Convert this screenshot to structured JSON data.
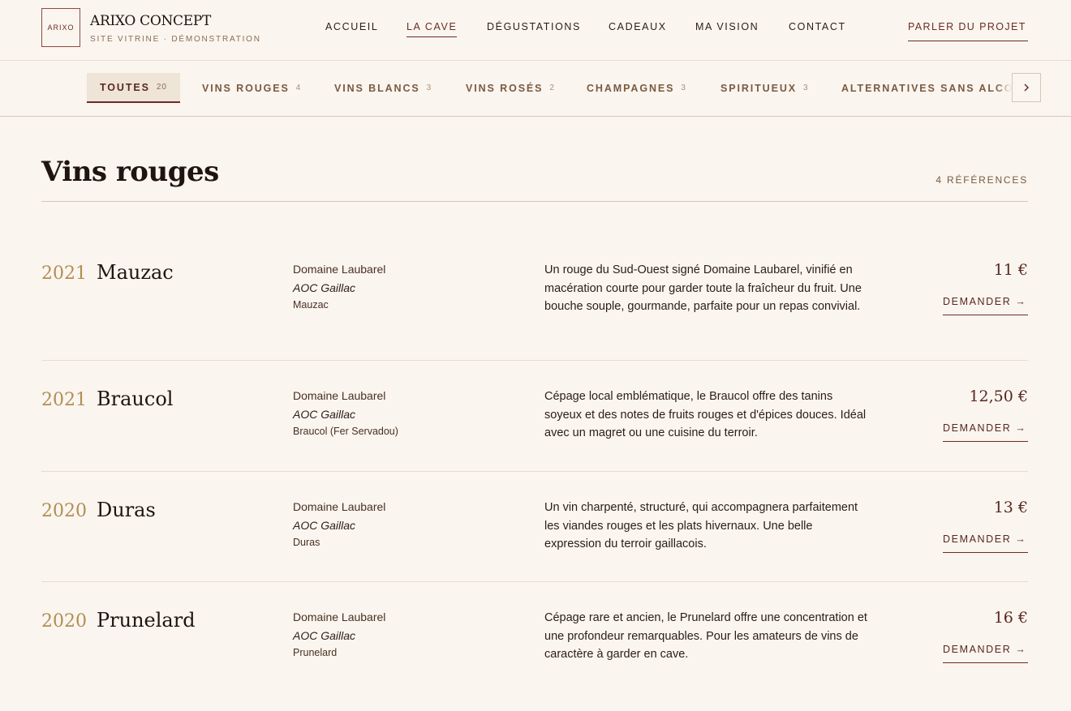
{
  "brand": {
    "logo_text": "ARIXO",
    "name": "ARIXO CONCEPT",
    "tagline": "SITE VITRINE · DÉMONSTRATION"
  },
  "nav": {
    "items": [
      "ACCUEIL",
      "LA CAVE",
      "DÉGUSTATIONS",
      "CADEAUX",
      "MA VISION",
      "CONTACT"
    ],
    "active": "LA CAVE",
    "cta": "PARLER DU PROJET"
  },
  "categories": [
    {
      "label": "TOUTES",
      "count": "20",
      "active": true
    },
    {
      "label": "VINS ROUGES",
      "count": "4"
    },
    {
      "label": "VINS BLANCS",
      "count": "3"
    },
    {
      "label": "VINS ROSÉS",
      "count": "2"
    },
    {
      "label": "CHAMPAGNES",
      "count": "3"
    },
    {
      "label": "SPIRITUEUX",
      "count": "3"
    },
    {
      "label": "ALTERNATIVES SANS ALCOOL",
      "count": ""
    }
  ],
  "icons": {
    "scroll_next": "chevron-right-icon"
  },
  "section": {
    "title": "Vins rouges",
    "count_label": "4 RÉFÉRENCES"
  },
  "wines": [
    {
      "vintage": "2021",
      "name": "Mauzac",
      "producer": "Domaine Laubarel",
      "appellation": "AOC Gaillac",
      "grape": "Mauzac",
      "description": "Un rouge du Sud-Ouest signé Domaine Laubarel, vinifié en macération courte pour garder toute la fraîcheur du fruit. Une bouche souple, gourmande, parfaite pour un repas convivial.",
      "price": "11 €",
      "action": "DEMANDER →"
    },
    {
      "vintage": "2021",
      "name": "Braucol",
      "producer": "Domaine Laubarel",
      "appellation": "AOC Gaillac",
      "grape": "Braucol (Fer Servadou)",
      "description": "Cépage local emblématique, le Braucol offre des tanins soyeux et des notes de fruits rouges et d'épices douces. Idéal avec un magret ou une cuisine du terroir.",
      "price": "12,50 €",
      "action": "DEMANDER →"
    },
    {
      "vintage": "2020",
      "name": "Duras",
      "producer": "Domaine Laubarel",
      "appellation": "AOC Gaillac",
      "grape": "Duras",
      "description": "Un vin charpenté, structuré, qui accompagnera parfaitement les viandes rouges et les plats hivernaux. Une belle expression du terroir gaillacois.",
      "price": "13 €",
      "action": "DEMANDER →"
    },
    {
      "vintage": "2020",
      "name": "Prunelard",
      "producer": "Domaine Laubarel",
      "appellation": "AOC Gaillac",
      "grape": "Prunelard",
      "description": "Cépage rare et ancien, le Prunelard offre une concentration et une profondeur remarquables. Pour les amateurs de vins de caractère à garder en cave.",
      "price": "16 €",
      "action": "DEMANDER →"
    }
  ],
  "colors": {
    "background": "#faf5ef",
    "accent": "#6d2b25",
    "vintage_gold": "#b38e55"
  }
}
